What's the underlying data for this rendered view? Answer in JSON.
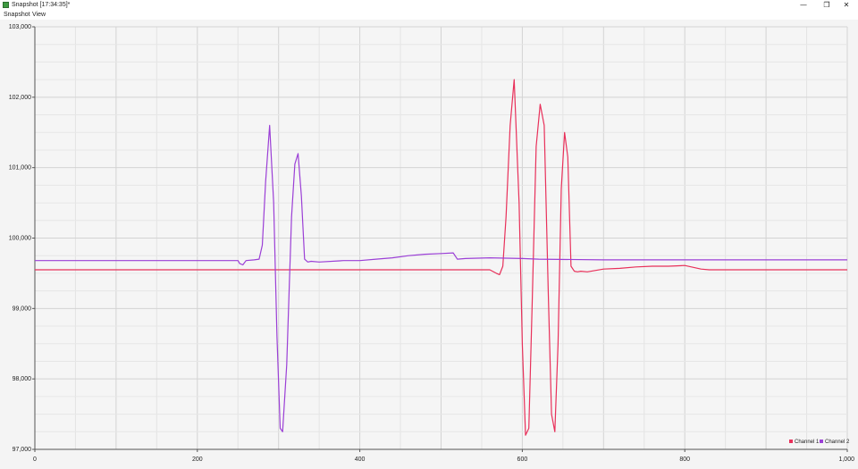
{
  "window": {
    "title": "Snapshot [17:34:35]*",
    "minimize_glyph": "—",
    "maximize_glyph": "❐",
    "close_glyph": "✕"
  },
  "menu": {
    "items": [
      "Snapshot",
      "View"
    ]
  },
  "chart_data": {
    "type": "line",
    "xlim": [
      0,
      1000
    ],
    "ylim": [
      97000,
      103000
    ],
    "x_ticks": [
      0,
      200,
      400,
      600,
      800,
      1000
    ],
    "x_tick_labels": [
      "0",
      "200",
      "400",
      "600",
      "800",
      "1,000"
    ],
    "y_ticks": [
      97000,
      98000,
      99000,
      100000,
      101000,
      102000,
      103000
    ],
    "y_tick_labels": [
      "97,000",
      "98,000",
      "99,000",
      "100,000",
      "101,000",
      "102,000",
      "103,000"
    ],
    "grid": true,
    "legend_position": "bottom-right",
    "series": [
      {
        "name": "Channel 1",
        "color": "#e8305a",
        "x": [
          0,
          560,
          568,
          572,
          576,
          580,
          585,
          590,
          596,
          600,
          604,
          608,
          612,
          617,
          622,
          627,
          632,
          636,
          640,
          644,
          648,
          652,
          656,
          660,
          664,
          668,
          672,
          680,
          700,
          720,
          740,
          760,
          780,
          800,
          820,
          830,
          1000
        ],
        "y": [
          99550,
          99550,
          99500,
          99480,
          99600,
          100300,
          101600,
          102250,
          100500,
          98500,
          97200,
          97300,
          99000,
          101300,
          101900,
          101600,
          99200,
          97500,
          97250,
          98500,
          100700,
          101500,
          101150,
          99600,
          99530,
          99520,
          99530,
          99520,
          99560,
          99570,
          99590,
          99600,
          99600,
          99610,
          99560,
          99550,
          99550
        ]
      },
      {
        "name": "Channel 2",
        "color": "#9b3fd6",
        "x": [
          0,
          250,
          252,
          256,
          260,
          270,
          276,
          280,
          284,
          289,
          294,
          298,
          302,
          305,
          310,
          316,
          320,
          324,
          328,
          332,
          336,
          340,
          350,
          380,
          400,
          420,
          440,
          460,
          480,
          500,
          515,
          520,
          530,
          560,
          600,
          620,
          700,
          800,
          900,
          1000
        ],
        "y": [
          99680,
          99680,
          99640,
          99620,
          99680,
          99690,
          99700,
          99900,
          100800,
          101600,
          100500,
          98600,
          97300,
          97250,
          98200,
          100300,
          101050,
          101200,
          100600,
          99700,
          99660,
          99670,
          99660,
          99680,
          99680,
          99700,
          99720,
          99750,
          99770,
          99780,
          99790,
          99700,
          99710,
          99720,
          99710,
          99700,
          99690,
          99690,
          99690,
          99690
        ]
      }
    ]
  }
}
